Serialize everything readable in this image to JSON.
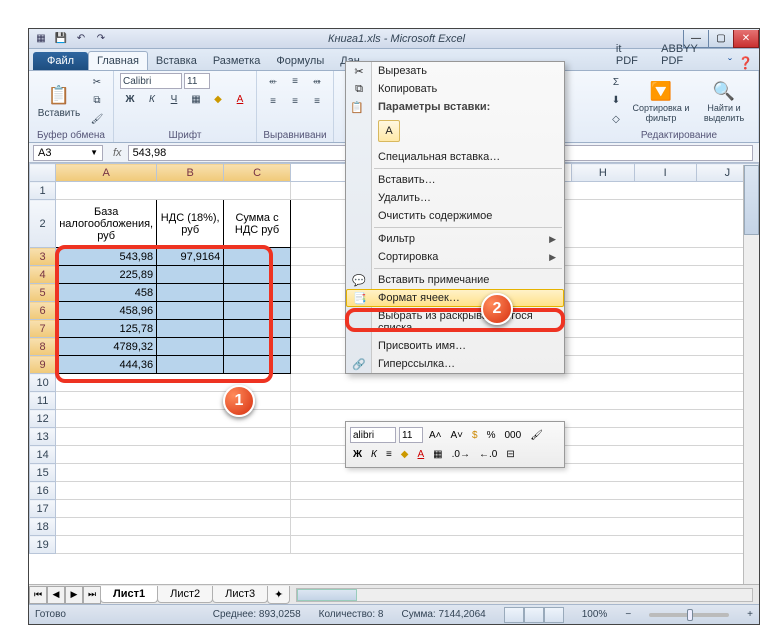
{
  "window": {
    "title": "Книга1.xls  -  Microsoft Excel",
    "qat_icons": [
      "excel-icon",
      "save-icon",
      "undo-icon",
      "redo-icon"
    ]
  },
  "ribbon_tabs": {
    "file": "Файл",
    "tabs": [
      "Главная",
      "Вставка",
      "Разметка",
      "Формулы",
      "Дан",
      "it PDF",
      "ABBYY PDF"
    ],
    "active_index": 0
  },
  "ribbon": {
    "clipboard": {
      "paste": "Вставить",
      "label": "Буфер обмена"
    },
    "font": {
      "name": "Calibri",
      "size": "11",
      "label": "Шрифт"
    },
    "alignment": {
      "label": "Выравнивани"
    },
    "editing": {
      "sort": "Сортировка и фильтр",
      "find": "Найти и выделить",
      "label": "Редактирование"
    }
  },
  "namebox": "A3",
  "formula": "543,98",
  "columns": [
    "A",
    "B",
    "C",
    "H",
    "I",
    "J"
  ],
  "rows": [
    "1",
    "2",
    "3",
    "4",
    "5",
    "6",
    "7",
    "8",
    "9",
    "10",
    "11",
    "12",
    "13",
    "14",
    "15",
    "16",
    "17",
    "18",
    "19"
  ],
  "header_row1": [
    "База налогообложения, руб",
    "НДС (18%), руб",
    "Сумма с НДС руб"
  ],
  "data": [
    [
      "543,98",
      "97,9164",
      ""
    ],
    [
      "225,89",
      "",
      ""
    ],
    [
      "458",
      "",
      ""
    ],
    [
      "458,96",
      "",
      ""
    ],
    [
      "125,78",
      "",
      ""
    ],
    [
      "4789,32",
      "",
      ""
    ],
    [
      "444,36",
      "",
      ""
    ]
  ],
  "context_menu": {
    "cut": "Вырезать",
    "copy": "Копировать",
    "paste_header": "Параметры вставки:",
    "paste_special": "Специальная вставка…",
    "insert": "Вставить…",
    "delete": "Удалить…",
    "clear": "Очистить содержимое",
    "filter": "Фильтр",
    "sort": "Сортировка",
    "comment": "Вставить примечание",
    "format_cells": "Формат ячеек…",
    "pick_list": "Выбрать из раскрывающегося списка…",
    "define_name": "Присвоить имя…",
    "hyperlink": "Гиперссылка…"
  },
  "mini_toolbar": {
    "font": "alibri",
    "size": "11"
  },
  "sheet_tabs": [
    "Лист1",
    "Лист2",
    "Лист3"
  ],
  "status": {
    "ready": "Готово",
    "average_label": "Среднее:",
    "average": "893,0258",
    "count_label": "Количество:",
    "count": "8",
    "sum_label": "Сумма:",
    "sum": "7144,2064",
    "zoom": "100%"
  },
  "callouts": {
    "one": "1",
    "two": "2"
  }
}
